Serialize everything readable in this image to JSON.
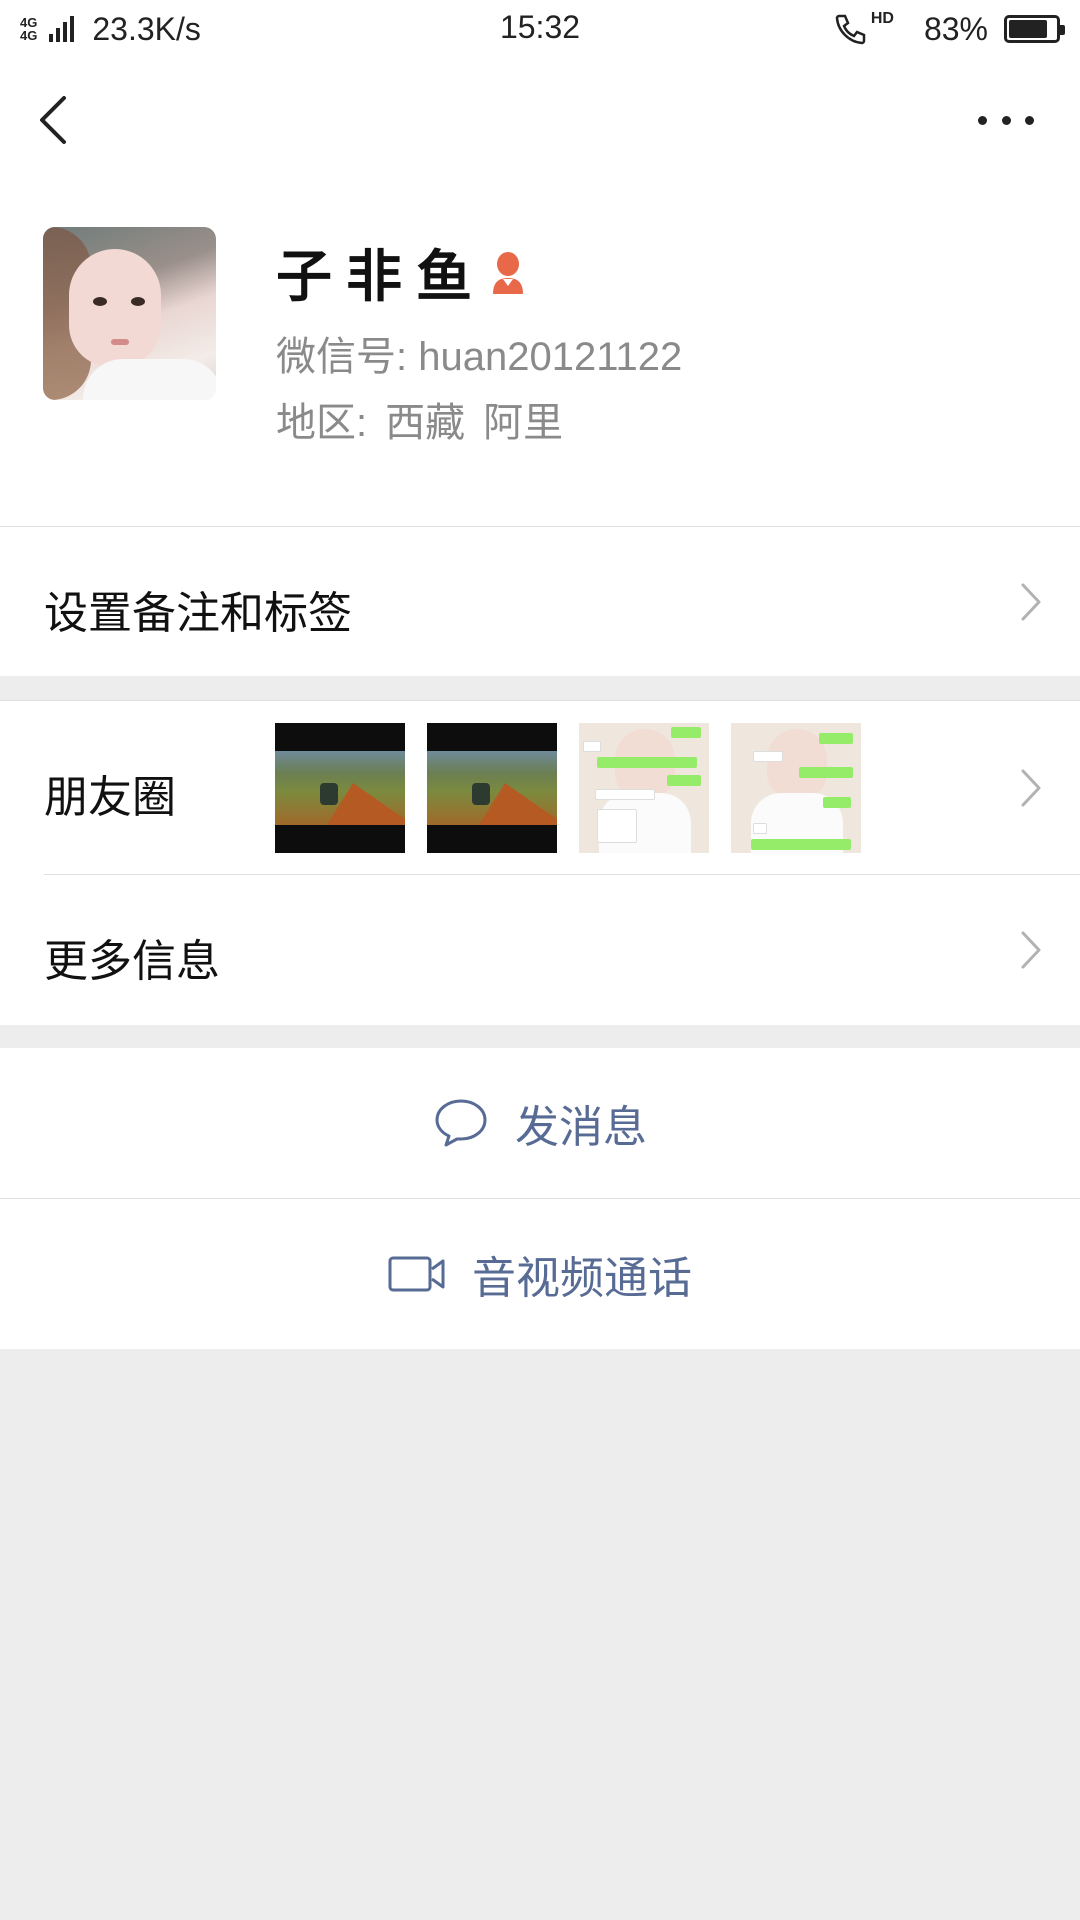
{
  "status_bar": {
    "network_top": "4G",
    "network_bottom": "4G",
    "speed": "23.3K/s",
    "time": "15:32",
    "hd": "HD",
    "battery_percent": "83%",
    "battery_level": 0.83
  },
  "nav": {
    "back_icon": "chevron-left-icon",
    "more_icon": "more-dots-icon"
  },
  "profile": {
    "nickname": "子非鱼",
    "gender_icon": "female-icon",
    "gender_color": "#e8684a",
    "wechat_id": "微信号: huan20121122",
    "region_label": "地区:",
    "region_province": "西藏",
    "region_city": "阿里"
  },
  "cells": {
    "remark_label": "设置备注和标签",
    "moments_label": "朋友圈",
    "more_info_label": "更多信息"
  },
  "actions": {
    "message_label": "发消息",
    "call_label": "音视频通话",
    "link_color": "#576b95"
  }
}
